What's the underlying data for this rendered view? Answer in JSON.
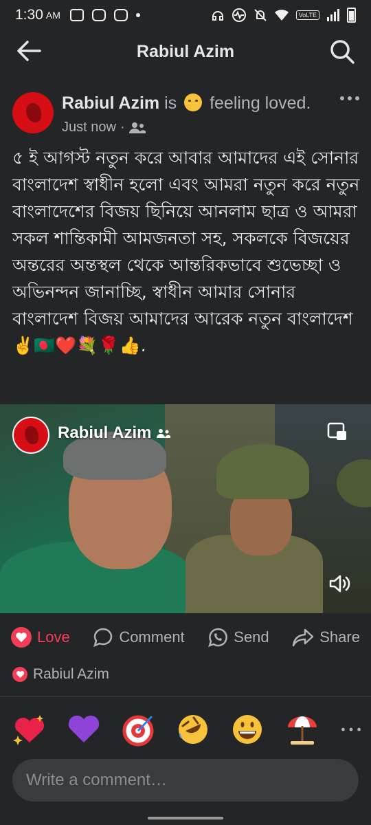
{
  "status_bar": {
    "time": "1:30",
    "ampm": "AM",
    "network": "VoLTE"
  },
  "header": {
    "title": "Rabiul Azim"
  },
  "post": {
    "author": "Rabiul Azim",
    "is_text": "is",
    "feeling": "feeling loved.",
    "time": "Just now",
    "dot": "·",
    "text": "৫ ই আগস্ট নতুন করে আবার আমাদের এই সোনার বাংলাদেশ স্বাধীন হলো এবং আমরা নতুন করে নতুন বাংলাদেশের বিজয় ছিনিয়ে আনলাম ছাত্র ও আমরা সকল  শান্তিকামী আমজনতা সহ, সকলকে বিজয়ের অন্তরের অন্তস্থল থেকে আন্তরিকভাবে শুভেচ্ছা ও অভিনন্দন জানাচ্ছি, স্বাধীন আমার সোনার বাংলাদেশ বিজয় আমাদের আরেক নতুন বাংলাদেশ✌️🇧🇩❤️💐🌹👍."
  },
  "media": {
    "overlay_name": "Rabiul Azim"
  },
  "actions": {
    "love": "Love",
    "comment": "Comment",
    "send": "Send",
    "share": "Share"
  },
  "reactions": {
    "reacted_by": "Rabiul Azim"
  },
  "emoji_row": [
    "sparkling-heart",
    "purple-heart",
    "direct-hit",
    "rolling-laughing",
    "grinning-face",
    "beach-umbrella"
  ],
  "comment": {
    "placeholder": "Write a comment…"
  },
  "colors": {
    "background": "#242526",
    "love": "#f33e58",
    "text": "#e4e6eb",
    "muted": "#b0b3b8",
    "input_bg": "#3a3b3c"
  }
}
